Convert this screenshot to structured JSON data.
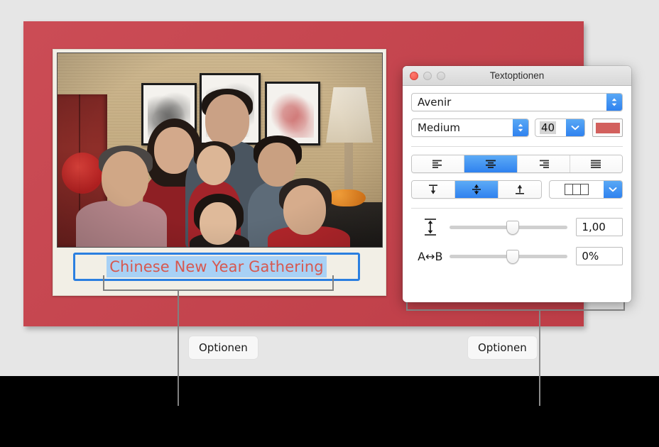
{
  "canvas": {
    "background_color": "#e6e6e6",
    "band_color": "#000000"
  },
  "document_card": {
    "background_color": "#c8414b",
    "photo_caption": "Chinese New Year Gathering",
    "caption_text_color": "#d7584f",
    "caption_selection_color": "#a8d1f5",
    "textbox_border_color": "#2b7fe0"
  },
  "panel": {
    "title": "Textoptionen",
    "window_buttons": {
      "close": "close-button",
      "minimize": "minimize-button",
      "zoom": "zoom-button"
    },
    "font": {
      "family_value": "Avenir",
      "style_value": "Medium",
      "size_value": "40",
      "color_swatch": "#d2605d"
    },
    "alignment": {
      "options": [
        "align-left",
        "align-center",
        "align-right",
        "align-justify"
      ],
      "selected_index": 1
    },
    "vertical_alignment": {
      "options": [
        "align-top",
        "align-middle",
        "align-bottom"
      ],
      "selected_index": 1
    },
    "columns": {
      "icon": "columns-icon"
    },
    "line_spacing": {
      "icon_label": "line-spacing-icon",
      "value": "1,00",
      "slider_percent": 48
    },
    "character_spacing": {
      "icon_label": "A↔B",
      "value": "0%",
      "slider_percent": 48
    }
  },
  "callouts": {
    "left_label": "Optionen",
    "right_label": "Optionen"
  }
}
